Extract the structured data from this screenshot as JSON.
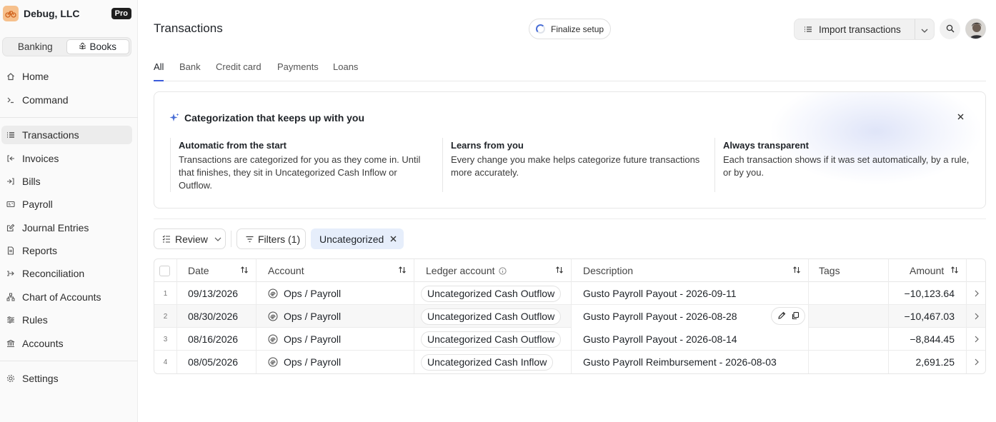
{
  "org": {
    "name": "Debug, LLC",
    "plan_badge": "Pro",
    "logo_icon": "org-logo-icon"
  },
  "mode_switch": {
    "options": [
      "Banking",
      "Books"
    ],
    "selected": "Books"
  },
  "sidebar": {
    "items": [
      {
        "label": "Home",
        "icon": "home-icon"
      },
      {
        "label": "Command",
        "icon": "terminal-icon"
      },
      {
        "label": "Transactions",
        "icon": "list-icon",
        "active": true
      },
      {
        "label": "Invoices",
        "icon": "invoice-icon"
      },
      {
        "label": "Bills",
        "icon": "bill-icon"
      },
      {
        "label": "Payroll",
        "icon": "payroll-icon"
      },
      {
        "label": "Journal Entries",
        "icon": "journal-icon"
      },
      {
        "label": "Reports",
        "icon": "report-icon"
      },
      {
        "label": "Reconciliation",
        "icon": "reconcile-icon"
      },
      {
        "label": "Chart of Accounts",
        "icon": "hierarchy-icon"
      },
      {
        "label": "Rules",
        "icon": "rules-icon"
      },
      {
        "label": "Accounts",
        "icon": "bank-icon"
      },
      {
        "label": "Settings",
        "icon": "gear-icon"
      }
    ]
  },
  "header": {
    "title": "Transactions",
    "finalize_label": "Finalize setup",
    "import_label": "Import transactions"
  },
  "tabs": [
    {
      "label": "All",
      "active": true
    },
    {
      "label": "Bank"
    },
    {
      "label": "Credit card"
    },
    {
      "label": "Payments"
    },
    {
      "label": "Loans"
    }
  ],
  "info_card": {
    "title": "Categorization that keeps up with you",
    "columns": [
      {
        "heading": "Automatic from the start",
        "body": "Transactions are categorized for you as they come in. Until that finishes, they sit in Uncategorized Cash Inflow or Outflow."
      },
      {
        "heading": "Learns from you",
        "body": "Every change you make helps categorize future transactions more accurately."
      },
      {
        "heading": "Always transparent",
        "body": "Each transaction shows if it was set automatically, by a rule, or by you."
      }
    ]
  },
  "toolbar": {
    "review_label": "Review",
    "filters_label": "Filters (1)",
    "active_filter": "Uncategorized"
  },
  "table": {
    "columns": [
      "Date",
      "Account",
      "Ledger account",
      "Description",
      "Tags",
      "Amount"
    ],
    "rows": [
      {
        "num": "1",
        "date": "09/13/2026",
        "account": "Ops / Payroll",
        "ledger": "Uncategorized Cash Outflow",
        "description": "Gusto Payroll Payout - 2026-09-11",
        "tags": "",
        "amount": "−10,123.64"
      },
      {
        "num": "2",
        "date": "08/30/2026",
        "account": "Ops / Payroll",
        "ledger": "Uncategorized Cash Outflow",
        "description": "Gusto Payroll Payout - 2026-08-28",
        "tags": "",
        "amount": "−10,467.03"
      },
      {
        "num": "3",
        "date": "08/16/2026",
        "account": "Ops / Payroll",
        "ledger": "Uncategorized Cash Outflow",
        "description": "Gusto Payroll Payout - 2026-08-14",
        "tags": "",
        "amount": "−8,844.45"
      },
      {
        "num": "4",
        "date": "08/05/2026",
        "account": "Ops / Payroll",
        "ledger": "Uncategorized Cash Inflow",
        "description": "Gusto Payroll Reimbursement - 2026-08-03",
        "tags": "",
        "amount": "2,691.25"
      }
    ]
  },
  "colors": {
    "accent": "#3b5bdb",
    "filter_chip_bg": "#e6eefb",
    "active_nav_bg": "#ececec"
  }
}
